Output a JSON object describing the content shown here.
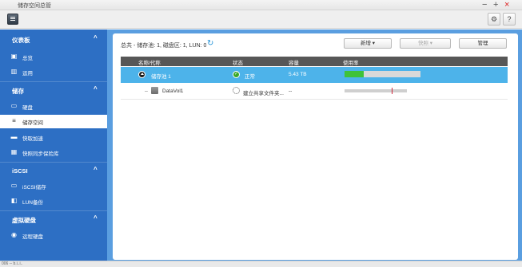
{
  "window": {
    "title": "储存空间总管",
    "controls": {
      "minimize": "−",
      "maximize": "+",
      "close": "×"
    }
  },
  "toolbar": {
    "app_icon": "storage-manager-icon",
    "gear": "⚙",
    "help": "?"
  },
  "sidebar": {
    "sections": [
      {
        "label": "仪表板",
        "chevron": "^",
        "items": [
          {
            "label": "总览",
            "icon": "overview-icon",
            "glyph": "▣"
          },
          {
            "label": "运用",
            "icon": "utilization-icon",
            "glyph": "▥"
          }
        ]
      },
      {
        "label": "储存",
        "chevron": "^",
        "items": [
          {
            "label": "硬盘",
            "icon": "disk-icon",
            "glyph": "▭"
          },
          {
            "label": "储存空间",
            "icon": "storage-space-icon",
            "glyph": "≡",
            "active": true
          },
          {
            "label": "快取加速",
            "icon": "cache-icon",
            "glyph": "▬"
          },
          {
            "label": "快照同步保险库",
            "icon": "snapshot-vault-icon",
            "glyph": "▦"
          }
        ]
      },
      {
        "label": "iSCSI",
        "chevron": "^",
        "items": [
          {
            "label": "iSCSI储存",
            "icon": "iscsi-storage-icon",
            "glyph": "▭"
          },
          {
            "label": "LUN备份",
            "icon": "lun-backup-icon",
            "glyph": "◧"
          }
        ]
      },
      {
        "label": "虚拟硬盘",
        "chevron": "^",
        "items": [
          {
            "label": "远程硬盘",
            "icon": "remote-disk-icon",
            "glyph": "◉"
          }
        ]
      }
    ]
  },
  "main": {
    "summary": "总共 - 储存池: 1, 磁盘区: 1, LUN: 0",
    "buttons": {
      "new": "新增 ▾",
      "snapshot": "快照 ▾",
      "manage": "管理"
    },
    "table": {
      "headers": [
        "名称/代称",
        "状态",
        "容量",
        "使用率"
      ],
      "rows": [
        {
          "name": "储存池 1",
          "status": "正常",
          "capacity": "5.43 TB",
          "usage_pct": 25
        },
        {
          "name": "DataVol1",
          "status": "建立共享文件夹...",
          "capacity": "--",
          "usage_pct": 76
        }
      ]
    }
  },
  "statusbar": {
    "text": "006 -- b.i..i.."
  },
  "colors": {
    "sidebar": "#2d6fc4",
    "main_bg": "#5a9ee0",
    "selected_row": "#4db3ea",
    "ok_green": "#3aa829",
    "usage_fill": "#3fc23a",
    "marker_red": "#d0263a"
  }
}
